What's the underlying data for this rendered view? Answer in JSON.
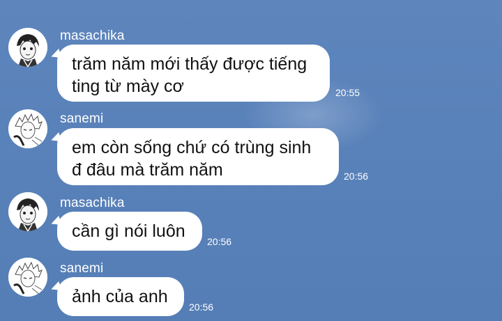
{
  "messages": [
    {
      "sender": "masachika",
      "text": "trăm năm mới thấy được tiếng\nting từ mày cơ",
      "time": "20:55",
      "avatar_icon": "masachika-avatar-icon"
    },
    {
      "sender": "sanemi",
      "text": "em còn sống chứ có trùng sinh\nđ đâu mà trăm năm",
      "time": "20:56",
      "avatar_icon": "sanemi-avatar-icon"
    },
    {
      "sender": "masachika",
      "text": "cần gì nói luôn",
      "time": "20:56",
      "avatar_icon": "masachika-avatar-icon"
    },
    {
      "sender": "sanemi",
      "text": "ảnh của anh",
      "time": "20:56",
      "avatar_icon": "sanemi-avatar-icon"
    }
  ],
  "colors": {
    "background": "#5a82ba",
    "bubble": "#ffffff",
    "text": "#111111",
    "meta_text": "#ffffff"
  }
}
